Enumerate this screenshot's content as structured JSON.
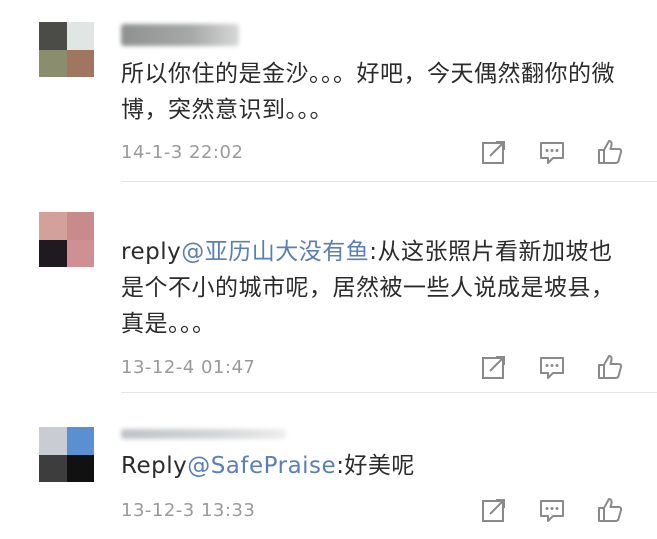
{
  "comments": [
    {
      "text": "所以你住的是金沙。。。好吧，今天偶然翻你的微博，突然意识到。。。",
      "prefix": "",
      "mention": "",
      "body": "",
      "time": "14-1-3 22:02",
      "avatar_colors": [
        "#4b4b48",
        "#dfe6e4",
        "#8a8e6c",
        "#a0765e"
      ],
      "username_colors": [
        "#8f9191",
        "#c8c8c8"
      ]
    },
    {
      "text": "",
      "prefix": "reply",
      "mention": "@亚历山大没有鱼",
      "body": ":从这张照片看新加坡也是个不小的城市呢，居然被一些人说成是坡县，真是。。。",
      "time": "13-12-4 01:47",
      "avatar_colors": [
        "#d4a19a",
        "#c98a8c",
        "#1f1a1f",
        "#cf8f93"
      ]
    },
    {
      "text": "",
      "prefix": "Reply",
      "mention": "@SafePraise",
      "body": ":好美呢",
      "time": "13-12-3 13:33",
      "avatar_colors": [
        "#c9cdd3",
        "#5a8fd1",
        "#3d3d3d",
        "#111111"
      ],
      "username_colors": [
        "#bfc3c7",
        "#e0e0e0"
      ]
    }
  ],
  "actions": [
    {
      "name": "share-icon"
    },
    {
      "name": "comment-icon"
    },
    {
      "name": "like-icon"
    }
  ]
}
